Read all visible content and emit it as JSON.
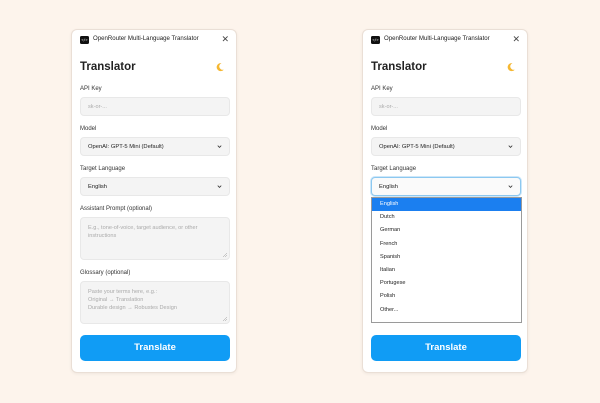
{
  "app": {
    "title": "OpenRouter Multi-Language Translator",
    "logo_text": "</>",
    "heading": "Translator"
  },
  "fields": {
    "api_key_label": "API Key",
    "api_key_placeholder": "sk-or-...",
    "model_label": "Model",
    "model_value": "OpenAI: GPT-5 Mini (Default)",
    "target_language_label": "Target Language",
    "target_language_value": "English",
    "assistant_prompt_label": "Assistant Prompt (optional)",
    "assistant_prompt_placeholder": "E.g., tone-of-voice, target audience, or other instructions",
    "glossary_label": "Glossary (optional)",
    "glossary_placeholder": "Paste your terms here, e.g.:\nOriginal → Translation\nDurable design → Robustes Design"
  },
  "translate_button": "Translate",
  "language_options": [
    "English",
    "Dutch",
    "German",
    "French",
    "Spanish",
    "Italian",
    "Portugese",
    "Polish",
    "Other..."
  ],
  "selected_language": "English",
  "colors": {
    "accent": "#109cf5",
    "selection": "#1b7ff0",
    "background": "#fdf4ec",
    "moon": "#f5b731"
  },
  "icons": {
    "theme": "moon-icon",
    "close": "close-icon",
    "chevron": "chevron-down-icon"
  }
}
